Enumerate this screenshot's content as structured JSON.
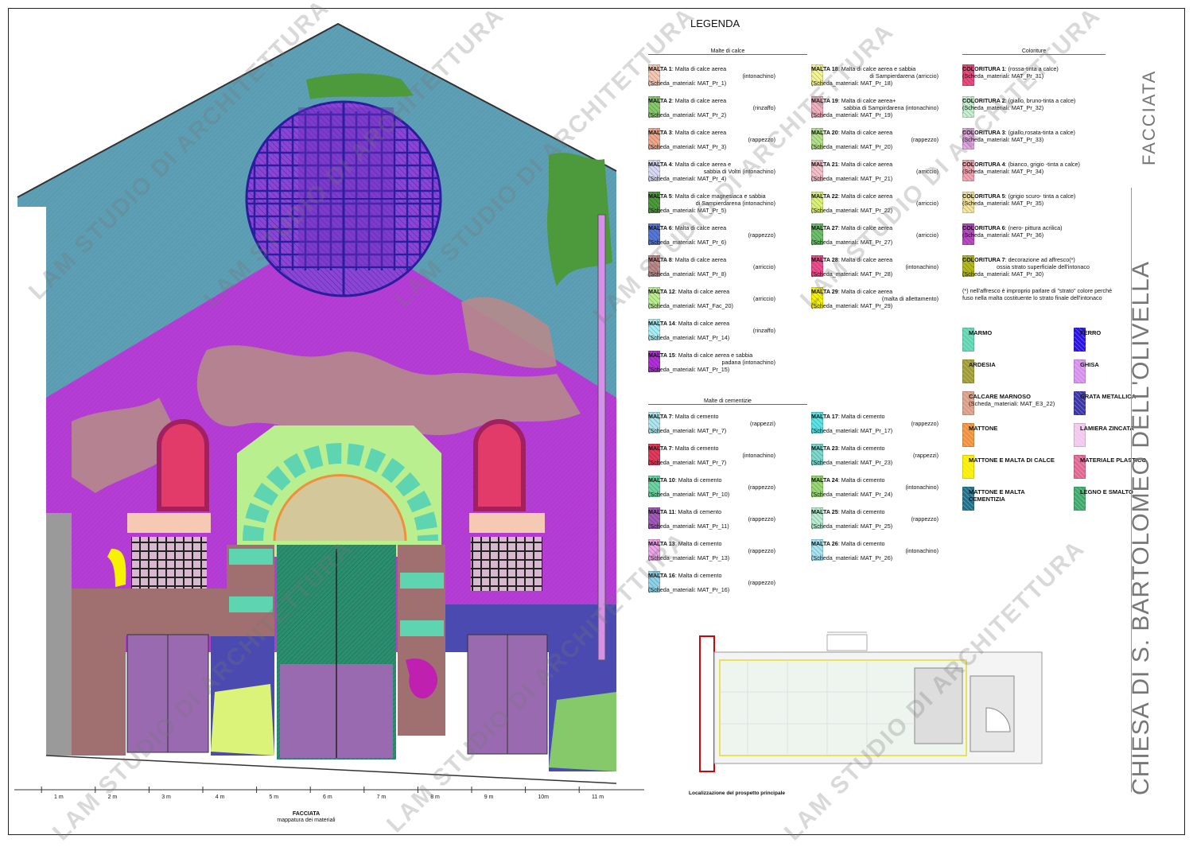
{
  "legend_title": "LEGENDA",
  "sections": {
    "malte_calce": "Malte di calce",
    "coloriture": "Coloriture",
    "malte_cementizie": "Malte di cementizie"
  },
  "lime_mortars": [
    {
      "code": "MALTA 1",
      "desc": "Malta di calce aerea",
      "desc2": "(intonachino)",
      "ref": "(Scheda_materiali: MAT_Pr_1)",
      "color": "#f6c9b5"
    },
    {
      "code": "MALTA 2",
      "desc": "Malta di calce aerea",
      "desc2": "(rinzaffo)",
      "ref": "(Scheda_materiali: MAT_Pr_2)",
      "color": "#86c96a"
    },
    {
      "code": "MALTA 3",
      "desc": "Malta di calce aerea",
      "desc2": "(rappezzo)",
      "ref": "(Scheda_materiali: MAT_Pr_3)",
      "color": "#f0a88c"
    },
    {
      "code": "MALTA 4",
      "desc": "Malta di calce aerea e",
      "desc2": "sabbia di Voltri (intonachino)",
      "ref": "(Scheda_materiali: MAT_Pr_4)",
      "color": "#d8daf5"
    },
    {
      "code": "MALTA 5",
      "desc": "Malta di calce magnesiaca e sabbia",
      "desc2": "di Sampierdarena (intonachino)",
      "ref": "(Scheda_materiali: MAT_Pr_5)",
      "color": "#4c9a3c"
    },
    {
      "code": "MALTA 6",
      "desc": "Malta di calce aerea",
      "desc2": "(rappezzo)",
      "ref": "(Scheda_materiali: MAT_Pr_6)",
      "color": "#5577d9"
    },
    {
      "code": "MALTA 8",
      "desc": "Malta di calce aerea",
      "desc2": "(arriccio)",
      "ref": "(Scheda_materiali: MAT_Pr_8)",
      "color": "#c48a8a"
    },
    {
      "code": "MALTA 12",
      "desc": "Malta di calce aerea",
      "desc2": "(arriccio)",
      "ref": "(Scheda_materiali: MAT_Fac_20)",
      "color": "#b9ef8f"
    },
    {
      "code": "MALTA 14",
      "desc": "Malta di calce aerea",
      "desc2": "(rinzaffo)",
      "ref": "(Scheda_materiali: MAT_Pr_14)",
      "color": "#a6f0f5"
    },
    {
      "code": "MALTA 15",
      "desc": "Malta di calce aerea e sabbia",
      "desc2": "padana (intonachino)",
      "ref": "(Scheda_materiali: MAT_Pr_15)",
      "color": "#b02fd8"
    },
    {
      "code": "MALTA 18",
      "desc": "Malta di calce aerea e sabbia",
      "desc2": "di Sampierdarena (arriccio)",
      "ref": "(Scheda_materiali: MAT_Pr_18)",
      "color": "#f3f596"
    },
    {
      "code": "MALTA 19",
      "desc": "Malta di calce aerea+",
      "desc2": "sabbia di Sampirdarena (intonachino)",
      "ref": "(Scheda_materiali: MAT_Pr_19)",
      "color": "#f2b0bf"
    },
    {
      "code": "MALTA 20",
      "desc": "Malta di calce aerea",
      "desc2": "(rappezzo)",
      "ref": "(Scheda_materiali: MAT_Pr_20)",
      "color": "#b5e08a"
    },
    {
      "code": "MALTA 21",
      "desc": "Malta di calce aerea",
      "desc2": "(arriccio)",
      "ref": "(Scheda_materiali: MAT_Pr_21)",
      "color": "#f4c1c8"
    },
    {
      "code": "MALTA 22",
      "desc": "Malta di calce aerea",
      "desc2": "(arriccio)",
      "ref": "(Scheda_materiali: MAT_Pr_22)",
      "color": "#dcf37a"
    },
    {
      "code": "MALTA 27",
      "desc": "Malta di calce aerea",
      "desc2": "(arriccio)",
      "ref": "(Scheda_materiali: MAT_Pr_27)",
      "color": "#6dbf6a"
    },
    {
      "code": "MALTA 28",
      "desc": "Malta di calce aerea",
      "desc2": "(intonachino)",
      "ref": "(Scheda_materiali: MAT_Pr_28)",
      "color": "#ef4d8e"
    },
    {
      "code": "MALTA 29",
      "desc": "Malta di calce aerea",
      "desc2": "(malta di allettamento)",
      "ref": "(Scheda_materiali: MAT_Pr_29)",
      "color": "#f6f200"
    }
  ],
  "colorings": [
    {
      "code": "COLORITURA 1",
      "desc": "(rossa-tinta a calce)",
      "ref": "(Scheda_materiali: MAT_Pr_31)",
      "color": "#e84d7d"
    },
    {
      "code": "COLORITURA 2",
      "desc": "(giallo, bruno-tinta a calce)",
      "ref": "(Scheda_materiali: MAT_Pr_32)",
      "color": "#c9f0d0"
    },
    {
      "code": "COLORITURA 3",
      "desc": "(giallo,rosata-tinta a calce)",
      "ref": "(Scheda_materiali: MAT_Pr_33)",
      "color": "#e7a8e4"
    },
    {
      "code": "COLORITURA 4",
      "desc": "(bianco, grigio -tinta a calce)",
      "ref": "(Scheda_materiali: MAT_Pr_34)",
      "color": "#f2a6b3"
    },
    {
      "code": "COLORITURA 5",
      "desc": "(grigio scuro- tinta a calce)",
      "ref": "(Scheda_materiali: MAT_Pr_35)",
      "color": "#f5e6a2"
    },
    {
      "code": "COLORITURA 6",
      "desc": "(nero- pittura acrilica)",
      "ref": "(Scheda_materiali: MAT_Pr_36)",
      "color": "#b84cc2"
    },
    {
      "code": "COLORITURA 7",
      "desc": "decorazione ad affresco(*)",
      "desc2": "ossia strato superficiale dell'intonaco",
      "ref": "(Scheda_materiali: MAT_Pr_30)",
      "color": "#b3b81d"
    }
  ],
  "note": "(*) nell'affresco è improprio parlare di \"strato\" colore perché fuso nella malta costituente lo strato finale dell'intonaco",
  "materials": [
    {
      "label": "MARMO",
      "color": "#5ed5b0"
    },
    {
      "label": "ARDESIA",
      "color": "#9f9a33"
    },
    {
      "label": "CALCARE MARNOSO",
      "sub": "(Scheda_materiali: MAT_E3_22)",
      "color": "#d99d86"
    },
    {
      "label": "MATTONE",
      "color": "#f08f3c"
    },
    {
      "label": "MATTONE E MALTA DI CALCE",
      "color": "#f8ee00"
    },
    {
      "label": "MATTONE E MALTA CEMENTIZIA",
      "color": "#1d6f8a"
    },
    {
      "label": "FERRO",
      "color": "#2a12e0"
    },
    {
      "label": "GHISA",
      "color": "#d690ec"
    },
    {
      "label": "GRATA METALLICA",
      "color": "#3b35a8"
    },
    {
      "label": "LAMIERA ZINCATA",
      "color": "#f2c8ee"
    },
    {
      "label": "MATERIALE PLASTICO",
      "color": "#e06590"
    },
    {
      "label": "LEGNO E SMALTO",
      "color": "#3ea96a"
    }
  ],
  "cement_mortars": [
    {
      "code": "MALTA 7",
      "desc": "Malta di cemento",
      "desc2": "(rappezzi)",
      "ref": "(Scheda_materiali: MAT_Pr_7)",
      "color": "#aee6ee"
    },
    {
      "code": "MALTA 7",
      "desc": "Malta di cemento",
      "desc2": "(intonachino)",
      "ref": "(Scheda_materiali: MAT_Pr_7)",
      "color": "#e23b5a"
    },
    {
      "code": "MALTA 10",
      "desc": "Malta di cemento",
      "desc2": "(rappezzo)",
      "ref": "(Scheda_materiali: MAT_Pr_10)",
      "color": "#6cd6a2"
    },
    {
      "code": "MALTA 11",
      "desc": "Malta di cemento",
      "desc2": "(rappezzo)",
      "ref": "(Scheda_materiali: MAT_Pr_11)",
      "color": "#a05ab8"
    },
    {
      "code": "MALTA 13",
      "desc": "Malta di cemento",
      "desc2": "(rappezzo)",
      "ref": "(Scheda_materiali: MAT_Pr_13)",
      "color": "#f0a6ec"
    },
    {
      "code": "MALTA 16",
      "desc": "Malta di cemento",
      "desc2": "(rappezzo)",
      "ref": "(Scheda_materiali: MAT_Pr_16)",
      "color": "#8fd3e8"
    },
    {
      "code": "MALTA 17",
      "desc": "Malta di cemento",
      "desc2": "(rappezzo)",
      "ref": "(Scheda_materiali: MAT_Pr_17)",
      "color": "#5ee3e6"
    },
    {
      "code": "MALTA 23",
      "desc": "Malta di cemento",
      "desc2": "(rappezzi)",
      "ref": "(Scheda_materiali: MAT_Pr_23)",
      "color": "#7ed9cf"
    },
    {
      "code": "MALTA 24",
      "desc": "Malta di cemento",
      "desc2": "(intonachino)",
      "ref": "(Scheda_materiali: MAT_Pr_24)",
      "color": "#9bd875"
    },
    {
      "code": "MALTA 25",
      "desc": "Malta di cemento",
      "desc2": "(rappezzo)",
      "ref": "(Scheda_materiali: MAT_Pr_25)",
      "color": "#b9ecd2"
    },
    {
      "code": "MALTA 26",
      "desc": "Malta di cemento",
      "desc2": "(intonachino)",
      "ref": "(Scheda_materiali: MAT_Pr_26)",
      "color": "#a8e4f4"
    }
  ],
  "scale_labels": [
    "1 m",
    "2 m",
    "3 m",
    "4 m",
    "5 m",
    "6 m",
    "7 m",
    "8 m",
    "9 m",
    "10m",
    "11 m"
  ],
  "drawing_caption": {
    "title": "FACCIATA",
    "subtitle": "mappatura dei materiali"
  },
  "location_caption": "Localizzazione del prospetto principale",
  "title_vertical": "CHIESA DI S. BARTOLOMEO DELL'OLIVELLA",
  "subtitle_vertical": "FACCIATA",
  "watermark": "LAM STUDIO DI ARCHITETTURA",
  "colors": {
    "facade_upper": "#5d9fb5",
    "facade_lower": "#b53dd6",
    "plaster_patch": "#b58a8a",
    "door": "#2b8e6f",
    "grid": "#2a1ea0"
  }
}
